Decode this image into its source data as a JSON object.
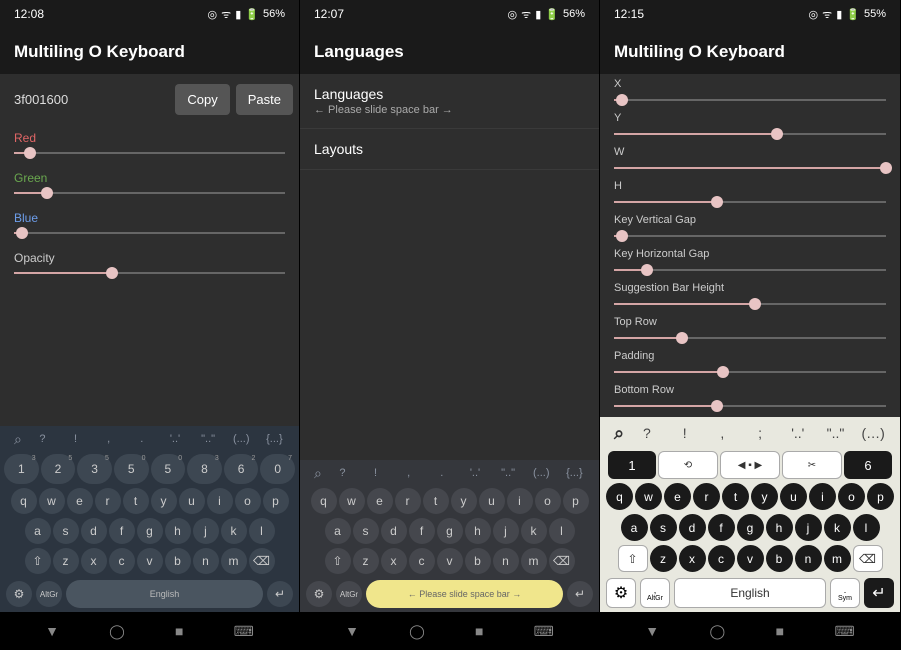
{
  "panels": [
    {
      "status": {
        "time": "12:08",
        "vibrate": "◎",
        "wifi": "ᯤ",
        "signal": "▮",
        "battery": "56%"
      },
      "title": "Multiling O Keyboard",
      "hex": "3f001600",
      "copy": "Copy",
      "paste": "Paste",
      "sliders": [
        {
          "label": "Red",
          "color": "#e06666",
          "pos": 6
        },
        {
          "label": "Green",
          "color": "#6aa84f",
          "pos": 12
        },
        {
          "label": "Blue",
          "color": "#6d9eeb",
          "pos": 3
        },
        {
          "label": "Opacity",
          "color": "#ccc",
          "pos": 36
        }
      ],
      "sugrow": [
        "?",
        "!",
        ",",
        ".",
        "'..'",
        "\"..\"",
        "(...)",
        "{...}"
      ],
      "numrow": [
        [
          "1",
          "3"
        ],
        [
          "2",
          "5"
        ],
        [
          "3",
          "5"
        ],
        [
          "5",
          "0"
        ],
        [
          "5",
          "0"
        ],
        [
          "8",
          "3"
        ],
        [
          "6",
          "2"
        ],
        [
          "0",
          "7"
        ]
      ],
      "qwerty": [
        "q",
        "w",
        "e",
        "r",
        "t",
        "y",
        "u",
        "i",
        "o",
        "p"
      ],
      "asdf": [
        "a",
        "s",
        "d",
        "f",
        "g",
        "h",
        "j",
        "k",
        "l"
      ],
      "zxcv": [
        "z",
        "x",
        "c",
        "v",
        "b",
        "n",
        "m"
      ],
      "space": "English",
      "altgr": "AltGr"
    },
    {
      "status": {
        "time": "12:07",
        "vibrate": "◎",
        "wifi": "ᯤ",
        "signal": "▮",
        "battery": "56%"
      },
      "title": "Languages",
      "items": [
        {
          "label": "Languages",
          "sub": "← Please slide space bar →"
        },
        {
          "label": "Layouts",
          "sub": ""
        }
      ],
      "sugrow": [
        "?",
        "!",
        ",",
        ".",
        "'..'",
        "\"..\"",
        "(...)",
        "{...}"
      ],
      "qwerty": [
        "q",
        "w",
        "e",
        "r",
        "t",
        "y",
        "u",
        "i",
        "o",
        "p"
      ],
      "asdf": [
        "a",
        "s",
        "d",
        "f",
        "g",
        "h",
        "j",
        "k",
        "l"
      ],
      "zxcv": [
        "z",
        "x",
        "c",
        "v",
        "b",
        "n",
        "m"
      ],
      "space": "← Please slide space bar →",
      "altgr": "AltGr"
    },
    {
      "status": {
        "time": "12:15",
        "vibrate": "◎",
        "wifi": "ᯤ",
        "signal": "▮",
        "battery": "55%"
      },
      "title": "Multiling O Keyboard",
      "sliders": [
        {
          "label": "X",
          "pos": 3
        },
        {
          "label": "Y",
          "pos": 60
        },
        {
          "label": "W",
          "pos": 100
        },
        {
          "label": "H",
          "pos": 38
        },
        {
          "label": "Key Vertical Gap",
          "pos": 3
        },
        {
          "label": "Key Horizontal Gap",
          "pos": 12
        },
        {
          "label": "Suggestion Bar Height",
          "pos": 52
        },
        {
          "label": "Top Row",
          "pos": 25
        },
        {
          "label": "Padding",
          "pos": 40
        },
        {
          "label": "Bottom Row",
          "pos": 38
        }
      ],
      "sugrow": [
        "?",
        "!",
        ",",
        ";",
        "'..'",
        "\"..\"",
        "(…)"
      ],
      "numleft": "1",
      "numright": "6",
      "tools": [
        "⟲",
        "◀ ▪ ▶",
        "✂"
      ],
      "qwerty": [
        "q",
        "w",
        "e",
        "r",
        "t",
        "y",
        "u",
        "i",
        "o",
        "p"
      ],
      "asdf": [
        "a",
        "s",
        "d",
        "f",
        "g",
        "h",
        "j",
        "k",
        "l"
      ],
      "zxcv": [
        "z",
        "x",
        "c",
        "v",
        "b",
        "n",
        "m"
      ],
      "space": "English",
      "altgr": "AltGr",
      "sym": "Sym",
      "comma": ",",
      "period": "."
    }
  ]
}
